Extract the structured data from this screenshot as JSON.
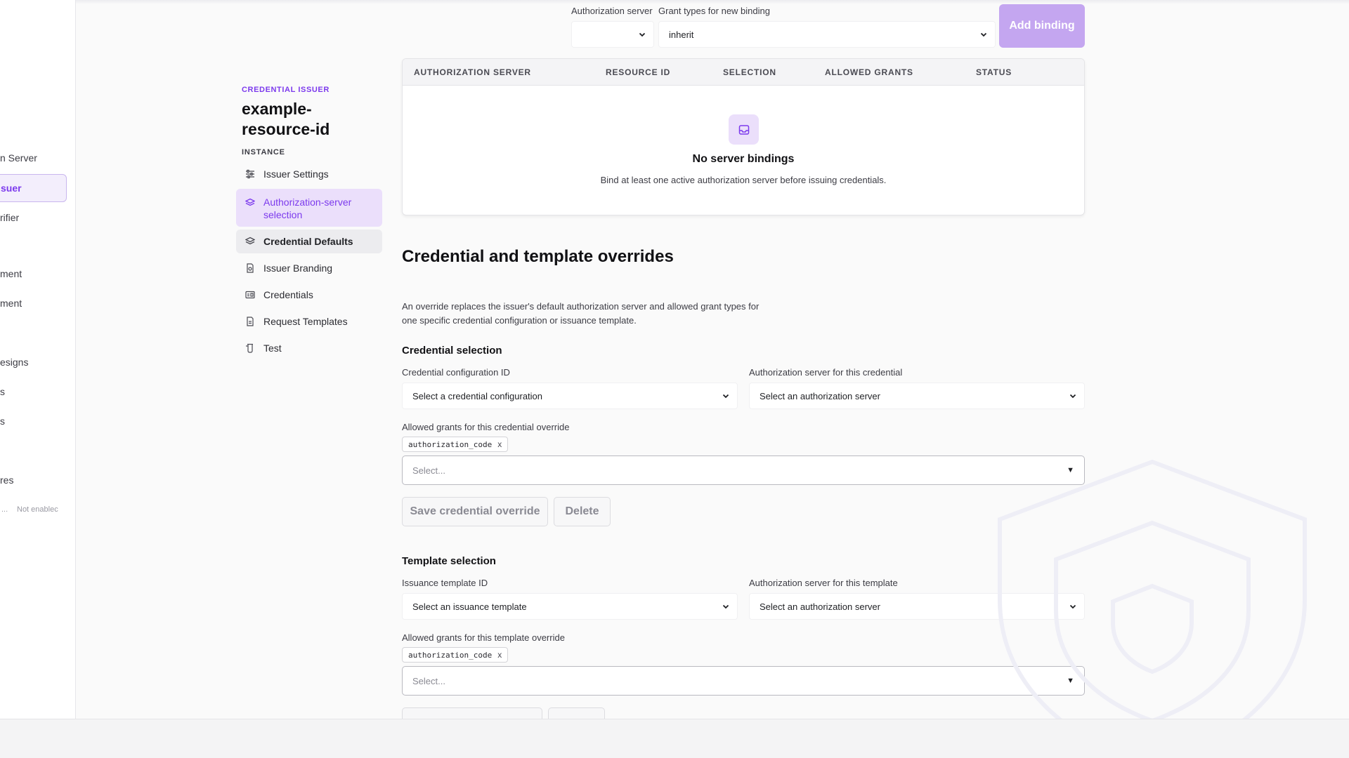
{
  "app_sidebar": {
    "items": [
      {
        "label": "n Server",
        "active": false
      },
      {
        "label": "suer",
        "active": true
      },
      {
        "label": "rifier",
        "active": false
      },
      {
        "label": "ment",
        "active": false
      },
      {
        "label": "ment",
        "active": false
      },
      {
        "label": "esigns",
        "active": false
      },
      {
        "label": "s",
        "active": false
      },
      {
        "label": "s",
        "active": false
      },
      {
        "label": "res",
        "active": false
      }
    ],
    "footer_left": "...",
    "footer_status": "Not enablec"
  },
  "secondary_nav": {
    "eyebrow": "CREDENTIAL ISSUER",
    "title": "example-resource-id",
    "section_label": "INSTANCE",
    "items": [
      {
        "label": "Issuer Settings",
        "icon": "sliders-icon"
      },
      {
        "label": "Authorization-server selection",
        "icon": "layers-icon"
      },
      {
        "label": "Credential Defaults",
        "icon": "layers-icon"
      },
      {
        "label": "Issuer Branding",
        "icon": "file-badge-icon"
      },
      {
        "label": "Credentials",
        "icon": "id-card-icon"
      },
      {
        "label": "Request Templates",
        "icon": "file-template-icon"
      },
      {
        "label": "Test",
        "icon": "flask-icon"
      }
    ]
  },
  "bindings": {
    "authorization_server_label": "Authorization server",
    "authorization_server_value": "",
    "grant_types_label": "Grant types for new binding",
    "grant_types_value": "inherit",
    "add_button": "Add binding",
    "table": {
      "columns": [
        "AUTHORIZATION SERVER",
        "RESOURCE ID",
        "SELECTION",
        "ALLOWED GRANTS",
        "STATUS"
      ],
      "rows": [],
      "empty_title": "No server bindings",
      "empty_subtitle": "Bind at least one active authorization server before issuing credentials."
    }
  },
  "overrides": {
    "title": "Credential and template overrides",
    "description": "An override replaces the issuer's default authorization server and allowed grant types for one specific credential configuration or issuance template.",
    "credential": {
      "heading": "Credential selection",
      "config_label": "Credential configuration ID",
      "config_placeholder": "Select a credential configuration",
      "server_label": "Authorization server for this credential",
      "server_placeholder": "Select an authorization server",
      "grants_label": "Allowed grants for this credential override",
      "chip": "authorization_code",
      "chip_remove": "x",
      "select_placeholder": "Select...",
      "save_button": "Save credential override",
      "delete_button": "Delete"
    },
    "template": {
      "heading": "Template selection",
      "template_label": "Issuance template ID",
      "template_placeholder": "Select an issuance template",
      "server_label": "Authorization server for this template",
      "server_placeholder": "Select an authorization server",
      "grants_label": "Allowed grants for this template override",
      "chip": "authorization_code",
      "chip_remove": "x",
      "select_placeholder": "Select..."
    }
  },
  "colors": {
    "accent": "#7c3aed",
    "accent_soft": "#ebdffb",
    "primary_button_disabled": "#c4a6f0"
  }
}
